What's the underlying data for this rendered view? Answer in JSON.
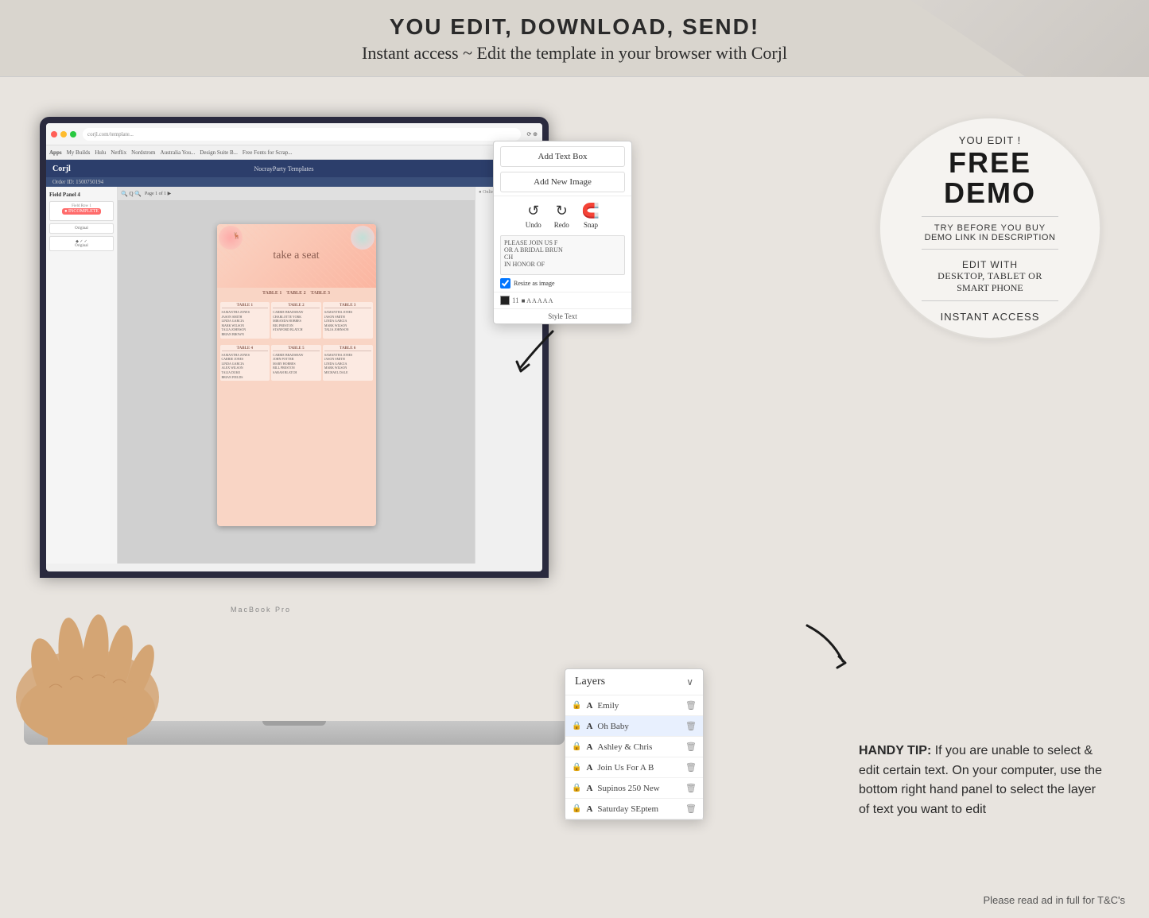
{
  "banner": {
    "title": "YOU EDIT, DOWNLOAD, SEND!",
    "subtitle": "Instant access ~ Edit the template in your browser with Corjl"
  },
  "demo_circle": {
    "you_edit": "YOU EDIT !",
    "free": "FREE",
    "demo": "DEMO",
    "try_before": "TRY BEFORE YOU BUY",
    "demo_link": "DEMO LINK IN DESCRIPTION",
    "edit_with": "EDIT WITH",
    "devices": "DESKTOP, TABLET OR",
    "smart_phone": "SMART PHONE",
    "instant_access": "INSTANT ACCESS"
  },
  "corjl_popup": {
    "add_text_box": "Add Text Box",
    "add_new_image": "Add New Image",
    "undo_label": "Undo",
    "redo_label": "Redo",
    "snap_label": "Snap",
    "sample_text": "PLEASE JOIN US F\nOR A BRIDAL BRUN\nCH\nIN HONOR OF",
    "resize_as_image": "Resize as image",
    "style_text": "Style Text"
  },
  "layers_panel": {
    "header": "Layers",
    "items": [
      {
        "id": 1,
        "name": "Emily",
        "locked": true,
        "selected": false
      },
      {
        "id": 2,
        "name": "Oh Baby",
        "locked": true,
        "selected": true
      },
      {
        "id": 3,
        "name": "Ashley & Chris",
        "locked": true,
        "selected": false
      },
      {
        "id": 4,
        "name": "Join Us For A B",
        "locked": true,
        "selected": false
      },
      {
        "id": 5,
        "name": "Supinos 250 New",
        "locked": true,
        "selected": false
      },
      {
        "id": 6,
        "name": "Saturday SEptem",
        "locked": true,
        "selected": false
      }
    ]
  },
  "handy_tip": {
    "prefix": "HANDY TIP:",
    "text": " If you are unable to select & edit certain text. On your computer, use the bottom right hand panel to select the layer of text you want to edit"
  },
  "seating_chart": {
    "title": "take a seat",
    "tables": [
      {
        "label": "TABLE 1",
        "names": [
          "SAMANTHA JONES",
          "JASON SMITH",
          "LINDA GARCIA",
          "MARK WILSON",
          "TALIA JOHNSON",
          "BRIAN BROWN"
        ]
      },
      {
        "label": "TABLE 2",
        "names": [
          "CARRIE BRADSHAW",
          "CHARLOTTE YORK",
          "MIRANDA HOBBES",
          "BIG PRESTON",
          "STANFORD BLATCH"
        ]
      },
      {
        "label": "TABLE 3",
        "names": [
          "SAMANTHA JONES",
          "JASON SMITH",
          "LINDA GARCIA",
          "MARK WILSON"
        ]
      }
    ]
  },
  "corjl_header": {
    "logo": "Corjl",
    "company": "NocrayParty Templates"
  },
  "order": {
    "id": "Order ID: 1500750194",
    "field_label": "Field Panel 4"
  },
  "footer": {
    "text": "Please read ad in full for T&C's"
  },
  "macbook_label": "MacBook Pro"
}
